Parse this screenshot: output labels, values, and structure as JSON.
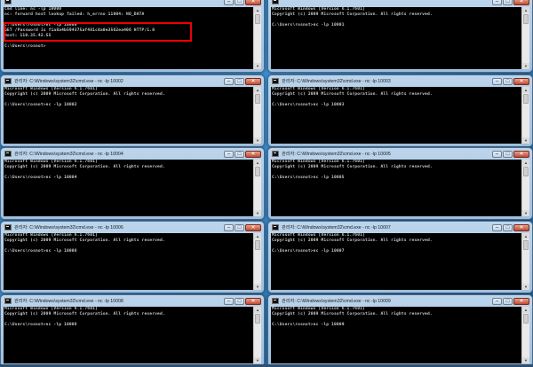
{
  "windows": [
    {
      "title": "",
      "lines": [
        "Cmd line: nc -lp 10000",
        "nc: forward host lookup failed: h_errno 11004: NO_DATA",
        "",
        "C:\\Users\\rosnot>nc -lp 10000",
        "GET /Password is f1a8a4b594375af481c8a0e3562ea406 HTTP/1.0",
        "Host: 110.35.42.55",
        "",
        "C:\\Users\\rosnot>"
      ]
    },
    {
      "title": "",
      "lines": [
        "Microsoft Windows [Version 6.1.7601]",
        "Copyright (c) 2009 Microsoft Corporation. All rights reserved.",
        "",
        "C:\\Users\\rosnot>nc -lp 10001"
      ]
    },
    {
      "title": "관리자: C:\\Windows\\system32\\cmd.exe - nc -lp 10002",
      "lines": [
        "Microsoft Windows [Version 6.1.7601]",
        "Copyright (c) 2009 Microsoft Corporation. All rights reserved.",
        "",
        "C:\\Users\\rosnot>nc -lp 10002"
      ]
    },
    {
      "title": "관리자: C:\\Windows\\system32\\cmd.exe - nc -lp 10003",
      "lines": [
        "Microsoft Windows [Version 6.1.7601]",
        "Copyright (c) 2009 Microsoft Corporation. All rights reserved.",
        "",
        "C:\\Users\\rosnot>nc -lp 10003"
      ]
    },
    {
      "title": "관리자: C:\\Windows\\system32\\cmd.exe - nc -lp 10004",
      "lines": [
        "Microsoft Windows [Version 6.1.7601]",
        "Copyright (c) 2009 Microsoft Corporation. All rights reserved.",
        "",
        "C:\\Users\\rosnot>nc -lp 10004"
      ]
    },
    {
      "title": "관리자: C:\\Windows\\system32\\cmd.exe - nc -lp 10005",
      "lines": [
        "Microsoft Windows [Version 6.1.7601]",
        "Copyright (c) 2009 Microsoft Corporation. All rights reserved.",
        "",
        "C:\\Users\\rosnot>nc -lp 10005"
      ]
    },
    {
      "title": "관리자: C:\\Windows\\system32\\cmd.exe - nc -lp 10006",
      "lines": [
        "Microsoft Windows [Version 6.1.7601]",
        "Copyright (c) 2009 Microsoft Corporation. All rights reserved.",
        "",
        "C:\\Users\\rosnot>nc -lp 10006"
      ]
    },
    {
      "title": "관리자: C:\\Windows\\system32\\cmd.exe - nc -lp 10007",
      "lines": [
        "Microsoft Windows [Version 6.1.7601]",
        "Copyright (c) 2009 Microsoft Corporation. All rights reserved.",
        "",
        "C:\\Users\\rosnot>nc -lp 10007"
      ]
    },
    {
      "title": "관리자: C:\\Windows\\system32\\cmd.exe - nc -lp 10008",
      "lines": [
        "Microsoft Windows [Version 6.1.7601]",
        "Copyright (c) 2009 Microsoft Corporation. All rights reserved.",
        "",
        "C:\\Users\\rosnot>nc -lp 10008"
      ]
    },
    {
      "title": "관리자: C:\\Windows\\system32\\cmd.exe - nc -lp 10009",
      "lines": [
        "Microsoft Windows [Version 6.1.7601]",
        "Copyright (c) 2009 Microsoft Corporation. All rights reserved.",
        "",
        "C:\\Users\\rosnot>nc -lp 10009"
      ]
    }
  ],
  "controls": {
    "minimize": "–",
    "maximize": "□",
    "close": "✕"
  },
  "icons": {
    "window": "cmd-icon",
    "scroll_up": "▲",
    "scroll_down": "▼"
  },
  "colors": {
    "console_bg": "#000000",
    "console_text": "#c8c8c8",
    "highlight": "#e00000",
    "titlebar": "#bcd5ec"
  }
}
